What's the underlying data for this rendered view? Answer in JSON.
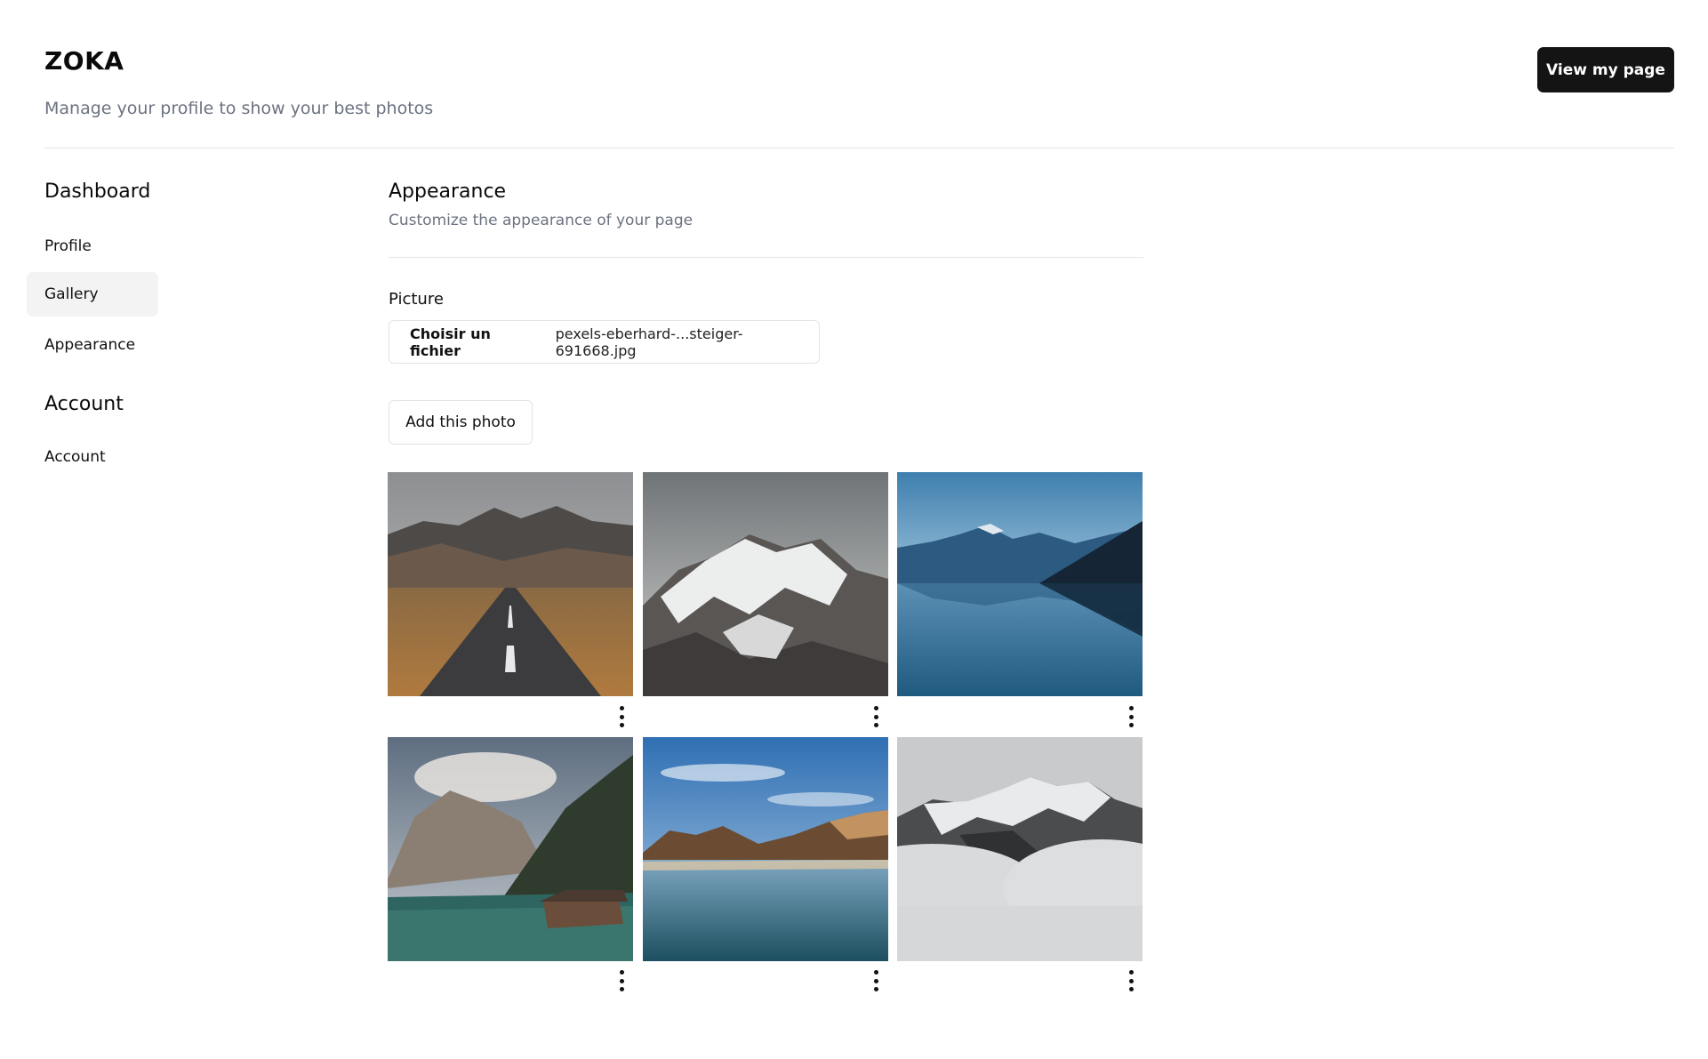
{
  "header": {
    "brand": "ZOKA",
    "tagline": "Manage your profile to show your best photos",
    "view_button": "View my page"
  },
  "sidebar": {
    "sections": [
      {
        "heading": "Dashboard",
        "items": [
          {
            "label": "Profile",
            "active": false
          },
          {
            "label": "Gallery",
            "active": true
          },
          {
            "label": "Appearance",
            "active": false
          }
        ]
      },
      {
        "heading": "Account",
        "items": [
          {
            "label": "Account",
            "active": false
          }
        ]
      }
    ]
  },
  "main": {
    "title": "Appearance",
    "subtitle": "Customize the appearance of your page",
    "picture_label": "Picture",
    "file_button": "Choisir un fichier",
    "file_name": "pexels-eberhard-...steiger-691668.jpg",
    "add_button": "Add this photo"
  },
  "gallery": {
    "photos": [
      {
        "subject": "road-mountain-photo"
      },
      {
        "subject": "snowy-peak-photo"
      },
      {
        "subject": "lake-reflection-photo"
      },
      {
        "subject": "alpine-lake-boathouse-photo"
      },
      {
        "subject": "blue-sky-lake-photo"
      },
      {
        "subject": "misty-peaks-photo"
      }
    ],
    "menu_icon": "more-vertical-icon"
  },
  "colors": {
    "primary_button_bg": "#141414",
    "muted_text": "#6b7280",
    "active_nav_bg": "#f3f3f4",
    "divider": "#e6e6e6"
  }
}
